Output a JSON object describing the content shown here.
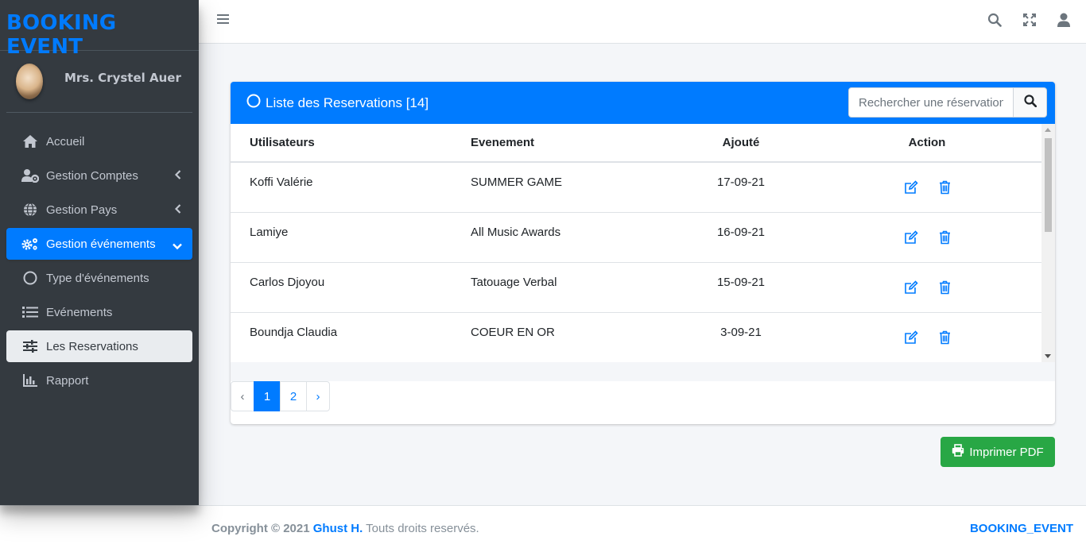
{
  "brand": {
    "name": "BOOKING EVENT"
  },
  "user": {
    "name": "Mrs. Crystel Auer"
  },
  "sidebar": {
    "items": [
      {
        "label": "Accueil",
        "icon": "home-icon"
      },
      {
        "label": "Gestion Comptes",
        "icon": "users-cog-icon"
      },
      {
        "label": "Gestion Pays",
        "icon": "globe-icon"
      },
      {
        "label": "Gestion événements",
        "icon": "cogs-icon"
      },
      {
        "label": "Type d'événements",
        "icon": "circle-icon"
      },
      {
        "label": "Evénements",
        "icon": "list-icon"
      },
      {
        "label": "Les Reservations",
        "icon": "sliders-icon"
      },
      {
        "label": "Rapport",
        "icon": "chart-bar-icon"
      }
    ]
  },
  "card": {
    "title": "Liste des Reservations [14]",
    "search_placeholder": "Rechercher une réservation"
  },
  "table": {
    "headers": [
      "Utilisateurs",
      "Evenement",
      "Ajouté",
      "Action"
    ],
    "rows": [
      {
        "user": "Koffi Valérie",
        "event": "SUMMER GAME",
        "date": "17-09-21"
      },
      {
        "user": "Lamiye",
        "event": "All Music Awards",
        "date": "16-09-21"
      },
      {
        "user": "Carlos Djoyou",
        "event": "Tatouage Verbal",
        "date": "15-09-21"
      },
      {
        "user": "Boundja Claudia",
        "event": "COEUR EN OR",
        "date": "3-09-21"
      }
    ]
  },
  "pagination": {
    "prev": "‹",
    "pages": [
      "1",
      "2"
    ],
    "next": "›",
    "current": "1"
  },
  "pdf_button": {
    "label": "Imprimer PDF"
  },
  "footer": {
    "copyright": "Copyright © 2021",
    "author": "Ghust H.",
    "rights": "Touts droits reservés.",
    "right_text": "BOOKING_EVENT"
  },
  "colors": {
    "primary": "#007bff",
    "sidebar": "#343a40",
    "success": "#28a745"
  }
}
